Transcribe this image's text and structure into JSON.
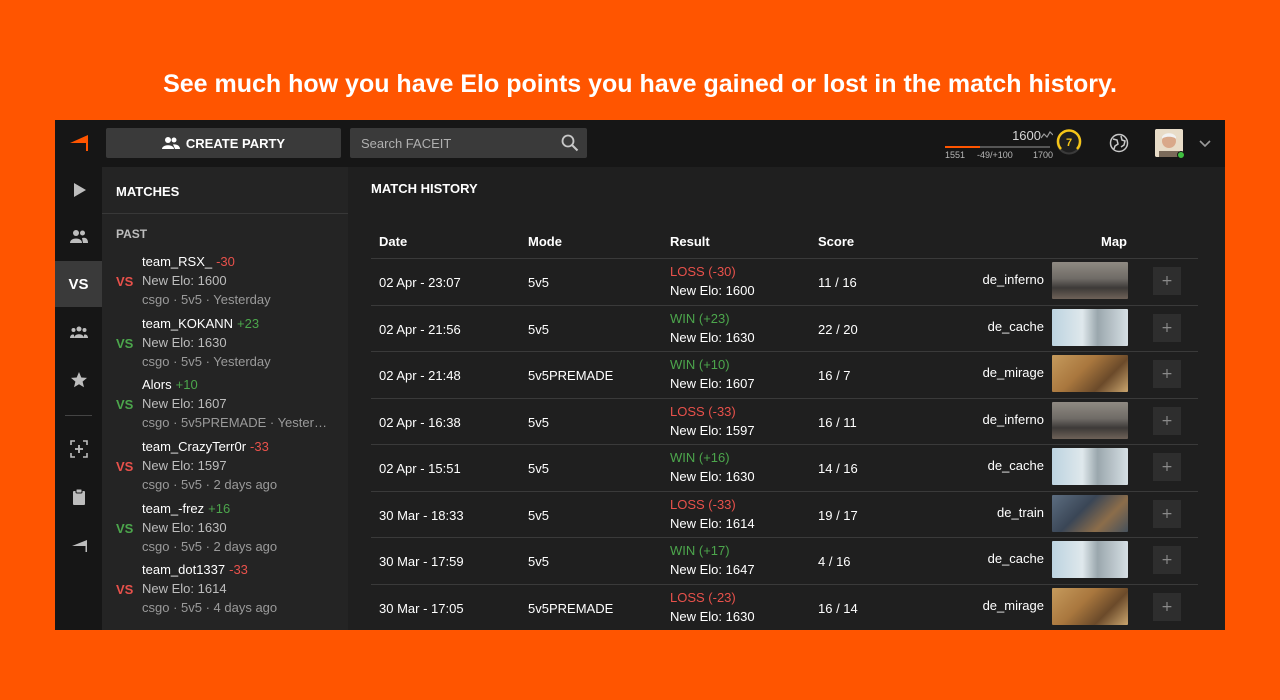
{
  "promo_title": "See much how you have Elo points you have gained or lost in the match history.",
  "topbar": {
    "create_party_label": "CREATE PARTY",
    "search_placeholder": "Search FACEIT",
    "elo": {
      "current": "1600",
      "min": "1551",
      "range": "-49/+100",
      "max": "1700",
      "progress_fraction": 0.33,
      "level": "7"
    },
    "accent_color": "#ff5500"
  },
  "rail": {
    "vs_label": "VS",
    "icons": [
      "play-icon",
      "party-icon",
      "vs-icon",
      "team-icon",
      "star-icon",
      "add-friend-icon",
      "clipboard-icon",
      "faceit-logo-icon"
    ]
  },
  "matches_panel": {
    "header": "MATCHES",
    "section_label": "PAST",
    "vs_text": "VS",
    "items": [
      {
        "team": "team_RSX_",
        "delta": "-30",
        "result": "loss",
        "elo": "New Elo: 1600",
        "meta": "csgo · 5v5 · Yesterday"
      },
      {
        "team": "team_KOKANN",
        "delta": "+23",
        "result": "win",
        "elo": "New Elo: 1630",
        "meta": "csgo · 5v5 · Yesterday"
      },
      {
        "team": "Alors",
        "delta": "+10",
        "result": "win",
        "elo": "New Elo: 1607",
        "meta": "csgo · 5v5PREMADE · Yesterd..."
      },
      {
        "team": "team_CrazyTerr0r",
        "delta": "-33",
        "result": "loss",
        "elo": "New Elo: 1597",
        "meta": "csgo · 5v5 · 2 days ago"
      },
      {
        "team": "team_-frez",
        "delta": "+16",
        "result": "win",
        "elo": "New Elo: 1630",
        "meta": "csgo · 5v5 · 2 days ago"
      },
      {
        "team": "team_dot1337",
        "delta": "-33",
        "result": "loss",
        "elo": "New Elo: 1614",
        "meta": "csgo · 5v5 · 4 days ago"
      }
    ]
  },
  "history": {
    "title": "MATCH HISTORY",
    "columns": {
      "date": "Date",
      "mode": "Mode",
      "result": "Result",
      "score": "Score",
      "map": "Map"
    },
    "plus_label": "+",
    "rows": [
      {
        "date": "02 Apr - 23:07",
        "mode": "5v5",
        "result": "LOSS (-30)",
        "outcome": "loss",
        "elo": "New Elo: 1600",
        "score": "11 / 16",
        "map": "de_inferno",
        "thumb": "inferno"
      },
      {
        "date": "02 Apr - 21:56",
        "mode": "5v5",
        "result": "WIN (+23)",
        "outcome": "win",
        "elo": "New Elo: 1630",
        "score": "22 / 20",
        "map": "de_cache",
        "thumb": "cache"
      },
      {
        "date": "02 Apr - 21:48",
        "mode": "5v5PREMADE",
        "result": "WIN (+10)",
        "outcome": "win",
        "elo": "New Elo: 1607",
        "score": "16 / 7",
        "map": "de_mirage",
        "thumb": "mirage"
      },
      {
        "date": "02 Apr - 16:38",
        "mode": "5v5",
        "result": "LOSS (-33)",
        "outcome": "loss",
        "elo": "New Elo: 1597",
        "score": "16 / 11",
        "map": "de_inferno",
        "thumb": "inferno"
      },
      {
        "date": "02 Apr - 15:51",
        "mode": "5v5",
        "result": "WIN (+16)",
        "outcome": "win",
        "elo": "New Elo: 1630",
        "score": "14 / 16",
        "map": "de_cache",
        "thumb": "cache"
      },
      {
        "date": "30 Mar - 18:33",
        "mode": "5v5",
        "result": "LOSS (-33)",
        "outcome": "loss",
        "elo": "New Elo: 1614",
        "score": "19 / 17",
        "map": "de_train",
        "thumb": "train"
      },
      {
        "date": "30 Mar - 17:59",
        "mode": "5v5",
        "result": "WIN (+17)",
        "outcome": "win",
        "elo": "New Elo: 1647",
        "score": "4 / 16",
        "map": "de_cache",
        "thumb": "cache"
      },
      {
        "date": "30 Mar - 17:05",
        "mode": "5v5PREMADE",
        "result": "LOSS (-23)",
        "outcome": "loss",
        "elo": "New Elo: 1630",
        "score": "16 / 14",
        "map": "de_mirage",
        "thumb": "mirage"
      }
    ]
  }
}
